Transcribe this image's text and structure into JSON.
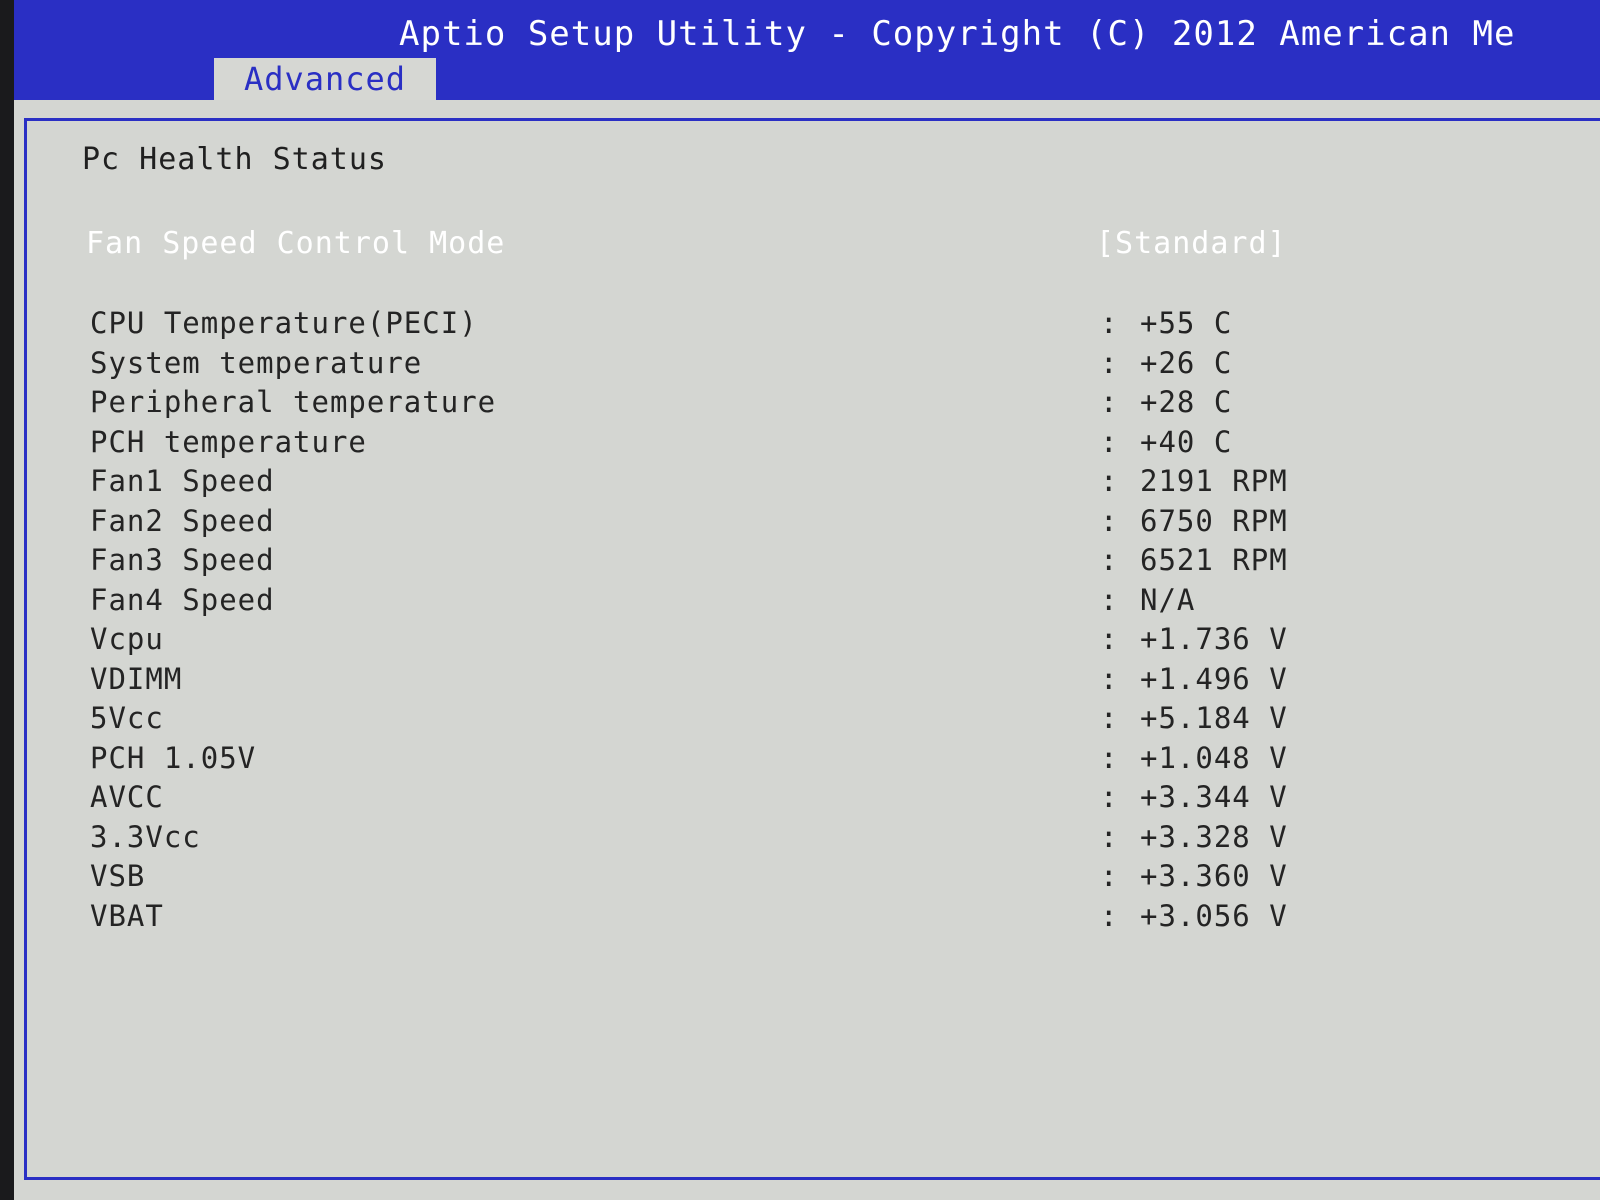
{
  "header": {
    "title": "Aptio Setup Utility - Copyright (C) 2012 American Me",
    "tab": "Advanced"
  },
  "section": {
    "title": "Pc Health Status"
  },
  "fan_control": {
    "label": "Fan Speed Control Mode",
    "value": "[Standard]"
  },
  "separator": ":",
  "readings": [
    {
      "label": "CPU Temperature(PECI)",
      "value": "+55 C"
    },
    {
      "label": "System temperature",
      "value": "+26 C"
    },
    {
      "label": "Peripheral temperature",
      "value": "+28 C"
    },
    {
      "label": "PCH temperature",
      "value": "+40 C"
    },
    {
      "label": "Fan1 Speed",
      "value": "2191 RPM"
    },
    {
      "label": "Fan2 Speed",
      "value": "6750 RPM"
    },
    {
      "label": "Fan3 Speed",
      "value": "6521 RPM"
    },
    {
      "label": "Fan4 Speed",
      "value": "N/A"
    },
    {
      "label": "Vcpu",
      "value": "+1.736 V"
    },
    {
      "label": "VDIMM",
      "value": "+1.496 V"
    },
    {
      "label": "5Vcc",
      "value": "+5.184 V"
    },
    {
      "label": "PCH 1.05V",
      "value": "+1.048 V"
    },
    {
      "label": "AVCC",
      "value": "+3.344 V"
    },
    {
      "label": "3.3Vcc",
      "value": "+3.328 V"
    },
    {
      "label": "VSB",
      "value": "+3.360 V"
    },
    {
      "label": "VBAT",
      "value": "+3.056 V"
    }
  ]
}
